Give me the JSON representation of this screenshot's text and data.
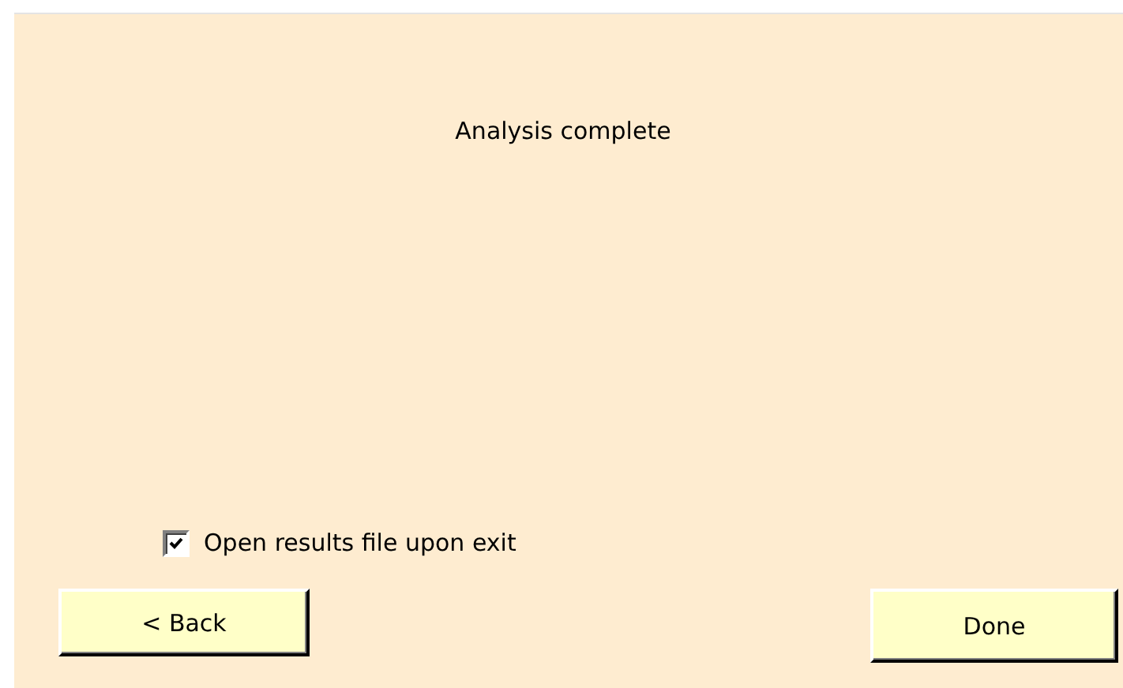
{
  "message": "Analysis complete",
  "open_results": {
    "label": "Open results file upon exit",
    "checked": true
  },
  "buttons": [
    {
      "label": "< Back",
      "kind": "back"
    },
    {
      "label": "Done",
      "kind": "done"
    }
  ]
}
